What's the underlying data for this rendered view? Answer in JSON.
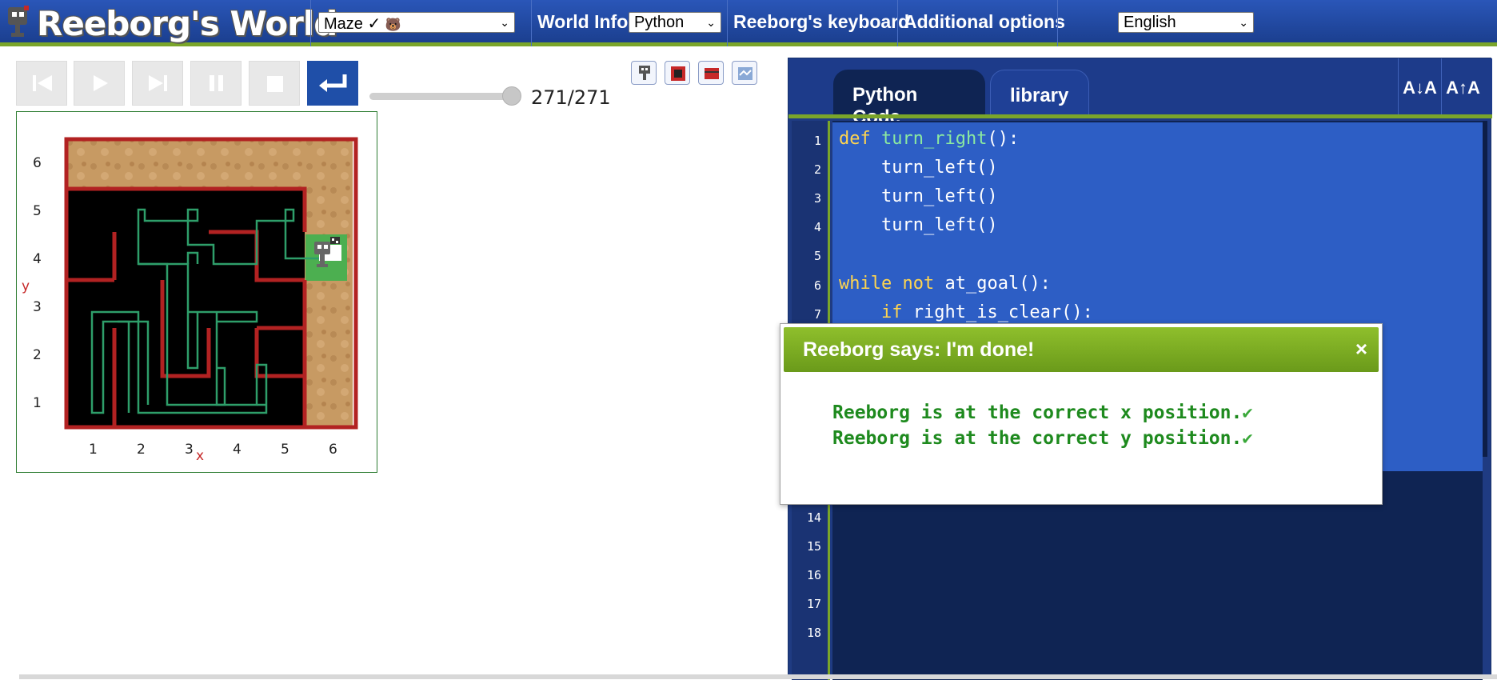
{
  "header": {
    "logo_text": "Reeborg's World",
    "world_select": "Maze ✓",
    "world_info": "World Info",
    "language_select": "Python",
    "keyboard": "Reeborg's keyboard",
    "additional_options": "Additional options",
    "ui_language_select": "English"
  },
  "controls": {
    "step_counter": "271/271",
    "slider_progress": 1.0,
    "buttons": [
      "reload-icon",
      "play-icon",
      "step-icon",
      "pause-icon",
      "stop-icon",
      "return-icon"
    ]
  },
  "world": {
    "x_ticks": [
      "1",
      "2",
      "3",
      "4",
      "5",
      "6"
    ],
    "y_ticks": [
      "6",
      "5",
      "4",
      "3",
      "2",
      "1"
    ],
    "x_label": "x",
    "y_label": "y"
  },
  "editor": {
    "tabs": [
      "Python Code",
      "library"
    ],
    "font_decrease": "A↓A",
    "font_increase": "A↑A",
    "line_numbers": [
      "1",
      "2",
      "3",
      "4",
      "5",
      "6",
      "7",
      "14",
      "15",
      "16",
      "17",
      "18"
    ]
  },
  "dialog": {
    "title": "Reeborg says: I'm done!",
    "close": "×",
    "line1": "Reeborg is at the correct x position.",
    "line2": "Reeborg is at the correct y position."
  },
  "colors": {
    "header_blue": "#1b3f8f",
    "accent_green": "#7aa52a",
    "editor_bg": "#0f2453",
    "selection_blue": "#2d5ec5",
    "success_green": "#1e8a1e"
  }
}
